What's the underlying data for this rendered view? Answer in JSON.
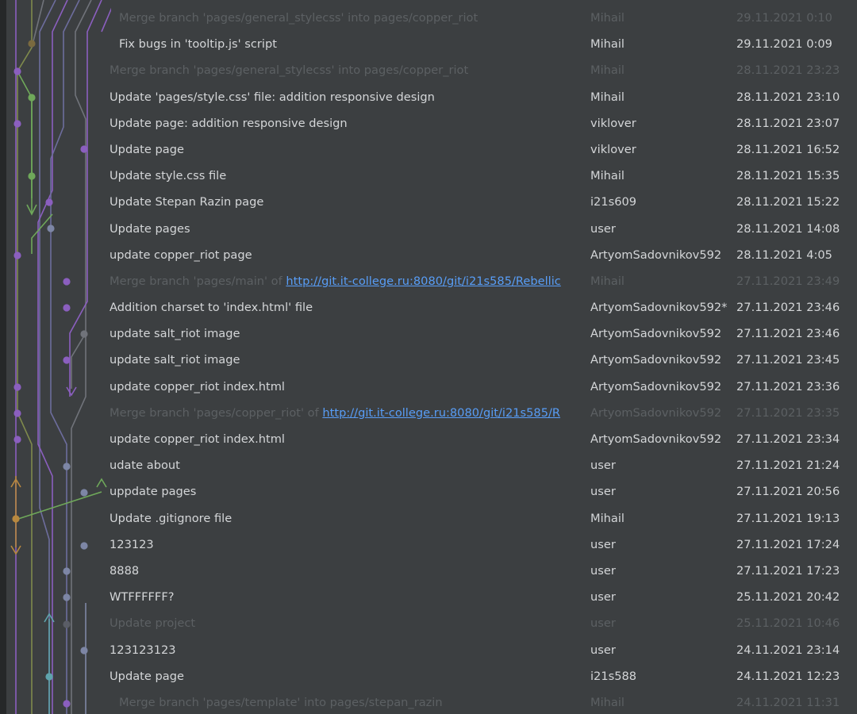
{
  "colors": {
    "background": "#3c3f41",
    "text": "#d4d6d8",
    "dim_text": "#5c6063",
    "link": "#589df6",
    "branch_purple": "#8b5fbf",
    "branch_lavender": "#6d6d9d",
    "branch_green": "#6fa85a",
    "branch_orange": "#b8883f",
    "branch_teal": "#5fa4ad",
    "branch_slate": "#7d86a5",
    "branch_gray": "#70737a",
    "branch_olive": "#7f8a4c"
  },
  "commits": [
    {
      "message": "Merge branch 'pages/general_stylecss' into pages/copper_riot",
      "author": "Mihail",
      "date": "29.11.2021 0:10",
      "dim": true,
      "indent": true
    },
    {
      "message": "Fix bugs in 'tooltip.js' script",
      "author": "Mihail",
      "date": "29.11.2021 0:09",
      "indent": true
    },
    {
      "message": "Merge branch 'pages/general_stylecss' into pages/copper_riot",
      "author": "Mihail",
      "date": "28.11.2021 23:23",
      "dim": true
    },
    {
      "message": "Update 'pages/style.css' file: addition responsive design",
      "author": "Mihail",
      "date": "28.11.2021 23:10"
    },
    {
      "message": "Update page: addition responsive design",
      "author": "viklover",
      "date": "28.11.2021 23:07"
    },
    {
      "message": "Update page",
      "author": "viklover",
      "date": "28.11.2021 16:52"
    },
    {
      "message": "Update style.css file",
      "author": "Mihail",
      "date": "28.11.2021 15:35"
    },
    {
      "message": "Update Stepan Razin page",
      "author": "i21s609",
      "date": "28.11.2021 15:22"
    },
    {
      "message": "Update pages",
      "author": "user",
      "date": "28.11.2021 14:08"
    },
    {
      "message": "update copper_riot page",
      "author": "ArtyomSadovnikov592",
      "date": "28.11.2021 4:05"
    },
    {
      "message": "Merge branch 'pages/main' of ",
      "link": "http://git.it-college.ru:8080/git/i21s585/Rebellic",
      "author": "Mihail",
      "date": "27.11.2021 23:49",
      "dim": true
    },
    {
      "message": "Addition charset to 'index.html' file",
      "author": "ArtyomSadovnikov592*",
      "date": "27.11.2021 23:46"
    },
    {
      "message": "update salt_riot image",
      "author": "ArtyomSadovnikov592",
      "date": "27.11.2021 23:46"
    },
    {
      "message": "update salt_riot image",
      "author": "ArtyomSadovnikov592",
      "date": "27.11.2021 23:45"
    },
    {
      "message": "update copper_riot index.html",
      "author": "ArtyomSadovnikov592",
      "date": "27.11.2021 23:36"
    },
    {
      "message": "Merge branch 'pages/copper_riot' of ",
      "link": "http://git.it-college.ru:8080/git/i21s585/R",
      "author": "ArtyomSadovnikov592",
      "date": "27.11.2021 23:35",
      "dim": true
    },
    {
      "message": "update copper_riot index.html",
      "author": "ArtyomSadovnikov592",
      "date": "27.11.2021 23:34"
    },
    {
      "message": "udate about",
      "author": "user",
      "date": "27.11.2021 21:24"
    },
    {
      "message": "uppdate pages",
      "author": "user",
      "date": "27.11.2021 20:56"
    },
    {
      "message": "Update .gitignore file",
      "author": "Mihail",
      "date": "27.11.2021 19:13"
    },
    {
      "message": "123123",
      "author": "user",
      "date": "27.11.2021 17:24"
    },
    {
      "message": "8888",
      "author": "user",
      "date": "27.11.2021 17:23"
    },
    {
      "message": "WTFFFFFF?",
      "author": "user",
      "date": "25.11.2021 20:42"
    },
    {
      "message": "Update project",
      "author": "user",
      "date": "25.11.2021 10:46",
      "dim": true
    },
    {
      "message": "123123123",
      "author": "user",
      "date": "24.11.2021 23:14"
    },
    {
      "message": "Update page",
      "author": "i21s588",
      "date": "24.11.2021 12:23"
    },
    {
      "message": "Merge branch 'pages/template' into pages/stepan_razin",
      "author": "Mihail",
      "date": "24.11.2021 11:31",
      "dim": true,
      "indent": true
    }
  ]
}
